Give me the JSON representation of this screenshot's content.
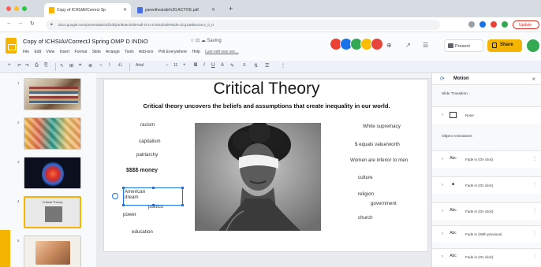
{
  "browser": {
    "tabs": [
      {
        "title": "Copy of ICHSIAI/Correct Sp",
        "active": true
      },
      {
        "title": "parenthesis&#x20;ACTIVE.pdf",
        "active": false
      }
    ],
    "url": "docs.google.com/presentation/d/1dhjrsrl8u6cSDhHsdl-GA1-tcl4SZ/edit#slide=id.g1a8b5c04c4_0_0",
    "update_label": "Update",
    "colors": {
      "close": "#ff5f57",
      "minimize": "#febc2e",
      "maximize": "#28c840"
    }
  },
  "header": {
    "doc_title": "Copy of ICHSIAI/CorrectJ Spring OMP D INDIO",
    "title_icons": "☆ ⊡ ☁ Saving",
    "menu": [
      "File",
      "Edit",
      "View",
      "Insert",
      "Format",
      "Slide",
      "Arrange",
      "Tools",
      "Add-ons",
      "Poll Everywhere",
      "Help"
    ],
    "last_edit": "Last edit was sec...",
    "present_label": "Present",
    "share_label": "Share",
    "avatar_colors": [
      "#ea4335",
      "#1a73e8",
      "#34a853",
      "#fbbc04",
      "#e8453c"
    ]
  },
  "toolbar": {
    "items": [
      "+",
      "↶",
      "↷",
      "⎙",
      "⎘",
      "↖",
      "⊞",
      "⌗",
      "⊕",
      "○",
      "\\",
      "⎌",
      "Arial",
      "−",
      "11",
      "+",
      "B",
      "I",
      "U",
      "A",
      "✎",
      "≡",
      "⇅",
      "☰",
      "⋮"
    ],
    "font": "Arial"
  },
  "filmstrip": {
    "slides": [
      {
        "number": "1"
      },
      {
        "number": "2"
      },
      {
        "number": "3"
      },
      {
        "number": "4",
        "caption": "Critical Theory"
      },
      {
        "number": "5"
      }
    ]
  },
  "slide": {
    "title": "Critical Theory",
    "subtitle": "Critical theory uncovers the beliefs and assumptions that create inequality in our world.",
    "left_words": [
      "racism",
      "capitalism",
      "patriarchy",
      "$$$$ money",
      "American dream",
      "politics",
      "power",
      "education"
    ],
    "right_words": [
      "White supremacy",
      "$ equals value/worth",
      "Women are inferior to men",
      "culture",
      "religion",
      "government",
      "church"
    ]
  },
  "panel": {
    "title": "Motion",
    "slide_transition_label": "Slide Transition",
    "transition_value": "None",
    "object_animations_label": "Object Animations",
    "animations": [
      {
        "icon": "Abc",
        "label": "Fade in  (On click)"
      },
      {
        "icon": "■",
        "label": "Fade in  (On click)"
      },
      {
        "icon": "Abc",
        "label": "Fade in  (On click)"
      },
      {
        "icon": "Abc",
        "label": "Fade in  (With previous)"
      },
      {
        "icon": "Abc",
        "label": "Fade in  (On click)"
      }
    ]
  }
}
